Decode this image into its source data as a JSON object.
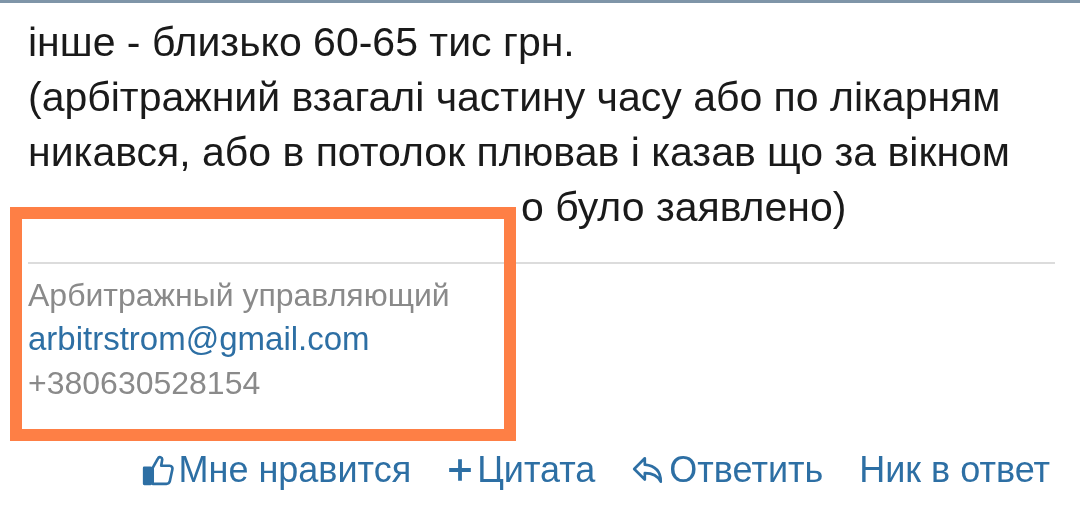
{
  "post": {
    "lines": [
      "інше - близько 60-65 тис грн.",
      "(арбітражний взагалі частину часу або по лікарням",
      "никався, або в потолок плював і казав що за вікном"
    ],
    "partly_covered_line": "о було заявлено)"
  },
  "signature": {
    "highlighted": true,
    "title": "Арбитражный управляющий",
    "email": "arbitrstrom@gmail.com",
    "phone": "+380630528154"
  },
  "actions": [
    {
      "kind": "like",
      "label": "Мне нравится"
    },
    {
      "kind": "quote",
      "label": "Цитата"
    },
    {
      "kind": "reply",
      "label": "Ответить"
    },
    {
      "kind": "nick",
      "label": "Ник в ответ"
    }
  ]
}
